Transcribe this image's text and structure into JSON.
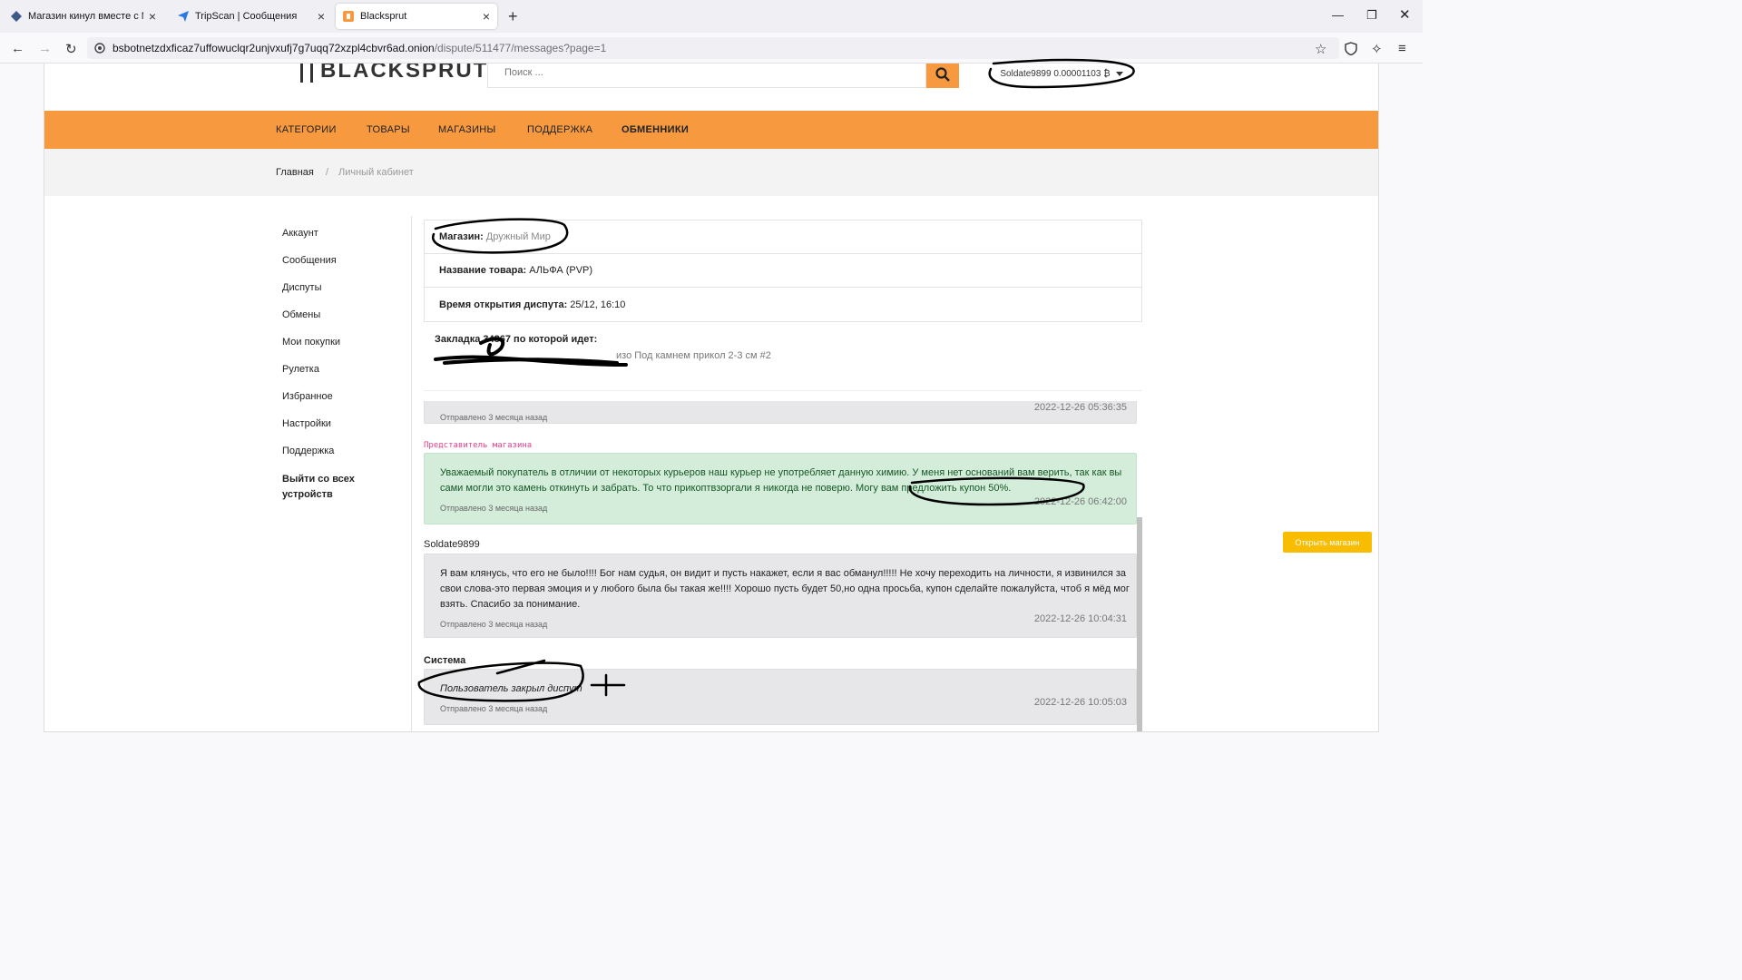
{
  "browser": {
    "tabs": [
      {
        "title": "Магазин кинул вместе с Модера",
        "active": false
      },
      {
        "title": "TripScan | Сообщения",
        "active": false
      },
      {
        "title": "Blacksprut",
        "active": true
      }
    ],
    "url_host": "bsbotnetzdxficaz7uffowuclqr2unjvxufj7g7uqq72xzpl4cbvr6ad.onion",
    "url_path": "/dispute/511477/messages?page=1"
  },
  "header": {
    "logo": "BLACKSPRUT",
    "search_placeholder": "Поиск ...",
    "account": "Soldate9899 0.00001103 ₿"
  },
  "menu": {
    "items": [
      "КАТЕГОРИИ",
      "ТОВАРЫ",
      "МАГАЗИНЫ",
      "ПОДДЕРЖКА",
      "ОБМЕННИКИ"
    ]
  },
  "breadcrumb": {
    "home": "Главная",
    "sep": "/",
    "current": "Личный кабинет"
  },
  "sidebar": {
    "items": [
      "Аккаунт",
      "Сообщения",
      "Диспуты",
      "Обмены",
      "Мои покупки",
      "Рулетка",
      "Избранное",
      "Настройки",
      "Поддержка"
    ],
    "logout": "Выйти со всех устройств"
  },
  "dispute": {
    "shop_label": "Магазин:",
    "shop_value": "Дружный Мир",
    "product_label": "Название товара:",
    "product_value": "АЛЬФА (PVP)",
    "opened_label": "Время открытия диспута:",
    "opened_value": "25/12, 16:10",
    "bookmark_title": "Закладка 34867 по которой идет:",
    "bookmark_detail": "изо Под камнем прикол 2-3 см #2"
  },
  "messages": [
    {
      "sender": "",
      "text": "",
      "sent": "Отправлено 3 месяца назад",
      "date": "2022-12-26 05:36:35"
    },
    {
      "sender": "Представитель магазина",
      "text": "Уважаемый покупатель в отличии от некоторых курьеров наш курьер не употребляет данную химию. У меня нет оснований вам верить, так как вы сами могли это камень откинуть и забрать. То что прикоптвзоргали я никогда не поверю. Могу вам предложить купон 50%.",
      "sent": "Отправлено 3 месяца назад",
      "date": "2022-12-26 06:42:00"
    },
    {
      "sender": "Soldate9899",
      "text": "Я вам клянусь, что его не было!!!! Бог нам судья, он видит и пусть накажет, если я вас обманул!!!!! Не хочу переходить на личности, я извинился за свои слова-это первая эмоция и у любого была бы такая же!!!! Хорошо пусть будет 50,но одна просьба, купон сделайте пожалуйста, чтоб я мёд мог взять. Спасибо за понимание.",
      "sent": "Отправлено 3 месяца назад",
      "date": "2022-12-26 10:04:31"
    },
    {
      "sender": "Система",
      "text": "Пользователь закрыл диспут",
      "sent": "Отправлено 3 месяца назад",
      "date": "2022-12-26 10:05:03"
    }
  ],
  "open_shop_button": "Открыть магазин"
}
